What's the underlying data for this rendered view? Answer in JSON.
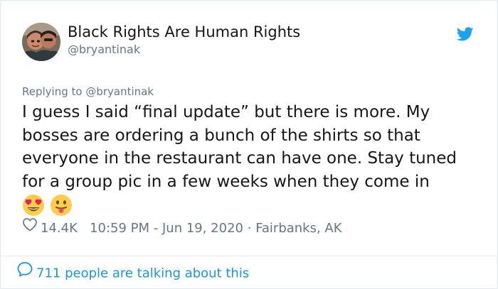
{
  "tweet": {
    "author": {
      "display_name": "Black Rights Are Human Rights",
      "handle": "@bryantinak",
      "avatar_icon": "profile-photo"
    },
    "reply_context": {
      "prefix": "Replying to",
      "target": "@bryantinak"
    },
    "text_lines": [
      "I guess I said “final update” but there is more. My",
      "bosses are ordering a bunch of the shirts so that",
      "everyone in the restaurant can have one. Stay tuned",
      "for a group pic in a few weeks when they come in"
    ],
    "emojis": [
      "heart-eyes-emoji",
      "tongue-out-emoji"
    ],
    "like_count": "14.4K",
    "timestamp": "10:59 PM - Jun 19, 2020",
    "separator": "·",
    "location": "Fairbanks, AK",
    "conversation_label": "711 people are talking about this"
  },
  "colors": {
    "brand_blue": "#1da1f2",
    "link_blue": "#1b95e0",
    "muted_gray": "#657786",
    "text_dark": "#14171a"
  }
}
